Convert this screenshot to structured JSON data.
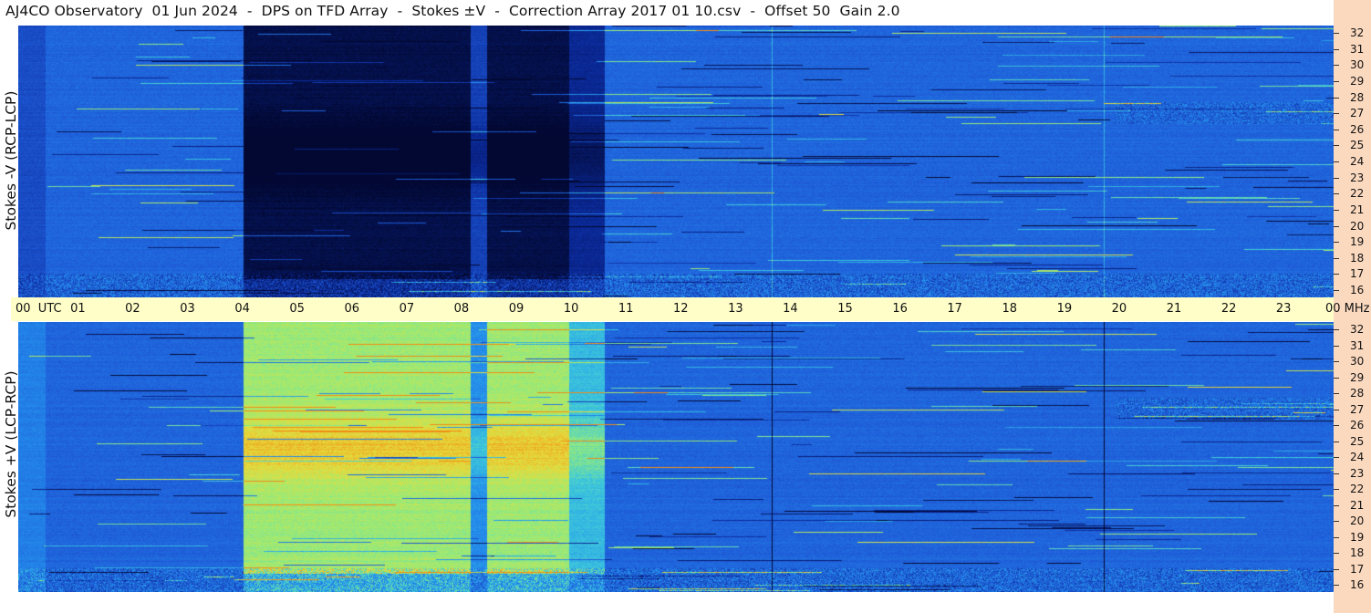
{
  "title": "AJ4CO Observatory  01 Jun 2024  -  DPS on TFD Array  -  Stokes ±V  -  Correction Array 2017 01 10.csv  -  Offset 50  Gain 2.0",
  "panels": [
    {
      "ylabel": "Stokes -V (RCP-LCP)"
    },
    {
      "ylabel": "Stokes +V (LCP-RCP)"
    }
  ],
  "time_axis": {
    "labels": [
      "00  UTC",
      "01",
      "02",
      "03",
      "04",
      "05",
      "06",
      "07",
      "08",
      "09",
      "10",
      "11",
      "12",
      "13",
      "14",
      "15",
      "16",
      "17",
      "18",
      "19",
      "20",
      "21",
      "22",
      "23",
      "00 MHz"
    ]
  },
  "freq_axis": {
    "labels": [
      "32",
      "31",
      "30",
      "29",
      "28",
      "27",
      "26",
      "25",
      "24",
      "23",
      "22",
      "21",
      "20",
      "19",
      "18",
      "17",
      "16"
    ]
  },
  "colors": {
    "background_blue": "#1f58d6",
    "dark": "#020a3a",
    "hot": "#f0b020",
    "axis_bg": "#fffec8",
    "strip_bg": "#fbd9bf"
  },
  "chart_data": {
    "type": "heatmap",
    "title": "AJ4CO Observatory  01 Jun 2024  -  DPS on TFD Array  -  Stokes ±V  -  Correction Array 2017 01 10.csv  -  Offset 50  Gain 2.0",
    "xlabel": "UTC",
    "ylabel": "MHz",
    "x_range": [
      0,
      24
    ],
    "y_range": [
      16,
      32
    ],
    "panels": [
      "Stokes -V (RCP-LCP)",
      "Stokes +V (LCP-RCP)"
    ],
    "features": [
      {
        "start_utc": 4.1,
        "end_utc": 10.7,
        "description": "strong polarized band, dark in -V, bright in +V"
      }
    ]
  }
}
